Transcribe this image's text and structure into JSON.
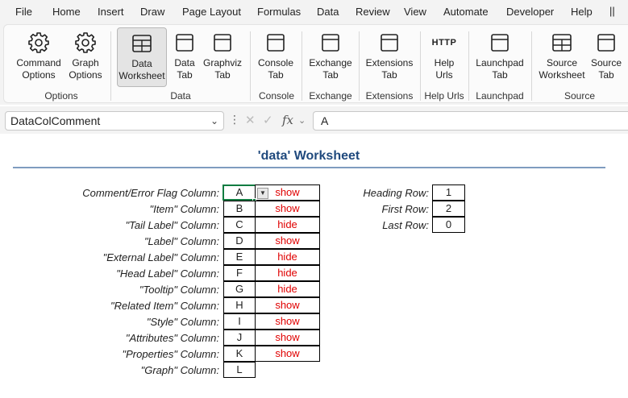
{
  "menu": [
    "File",
    "Home",
    "Insert",
    "Draw",
    "Page Layout",
    "Formulas",
    "Data",
    "Review",
    "View",
    "Automate",
    "Developer",
    "Help"
  ],
  "menu_extra": "||",
  "ribbon": {
    "buttons": [
      {
        "line1": "Command",
        "line2": "Options",
        "icon": "gear-icon"
      },
      {
        "line1": "Graph",
        "line2": "Options",
        "icon": "gear-icon"
      },
      {
        "line1": "Data",
        "line2": "Worksheet",
        "icon": "table-icon",
        "active": true
      },
      {
        "line1": "Data",
        "line2": "Tab",
        "icon": "tab-icon"
      },
      {
        "line1": "Graphviz",
        "line2": "Tab",
        "icon": "tab-icon"
      },
      {
        "line1": "Console",
        "line2": "Tab",
        "icon": "tab-icon"
      },
      {
        "line1": "Exchange",
        "line2": "Tab",
        "icon": "tab-icon"
      },
      {
        "line1": "Extensions",
        "line2": "Tab",
        "icon": "tab-icon"
      },
      {
        "line1": "Help",
        "line2": "Urls",
        "icon": "http-icon",
        "icon_text": "HTTP"
      },
      {
        "line1": "Launchpad",
        "line2": "Tab",
        "icon": "tab-icon"
      },
      {
        "line1": "Source",
        "line2": "Worksheet",
        "icon": "table-icon"
      },
      {
        "line1": "Source",
        "line2": "Tab",
        "icon": "tab-icon"
      }
    ],
    "groups": [
      "Options",
      "Data",
      "Console",
      "Exchange",
      "Extensions",
      "Help Urls",
      "Launchpad",
      "Source"
    ]
  },
  "formula_bar": {
    "name_box": "DataColComment",
    "fx": "fx",
    "value": "A"
  },
  "sheet": {
    "title": "'data' Worksheet",
    "columns": [
      {
        "label": "Comment/Error Flag Column:",
        "col": "A",
        "flag": "show"
      },
      {
        "label": "\"Item\" Column:",
        "col": "B",
        "flag": "show"
      },
      {
        "label": "\"Tail Label\" Column:",
        "col": "C",
        "flag": "hide"
      },
      {
        "label": "\"Label\" Column:",
        "col": "D",
        "flag": "show"
      },
      {
        "label": "\"External Label\" Column:",
        "col": "E",
        "flag": "hide"
      },
      {
        "label": "\"Head Label\" Column:",
        "col": "F",
        "flag": "hide"
      },
      {
        "label": "\"Tooltip\" Column:",
        "col": "G",
        "flag": "hide"
      },
      {
        "label": "\"Related Item\" Column:",
        "col": "H",
        "flag": "show"
      },
      {
        "label": "\"Style\" Column:",
        "col": "I",
        "flag": "show"
      },
      {
        "label": "\"Attributes\" Column:",
        "col": "J",
        "flag": "show"
      },
      {
        "label": "\"Properties\" Column:",
        "col": "K",
        "flag": "show"
      },
      {
        "label": "\"Graph\" Column:",
        "col": "L",
        "flag": ""
      }
    ],
    "rows": [
      {
        "label": "Heading Row:",
        "value": "1"
      },
      {
        "label": "First Row:",
        "value": "2"
      },
      {
        "label": "Last Row:",
        "value": "0"
      }
    ]
  }
}
